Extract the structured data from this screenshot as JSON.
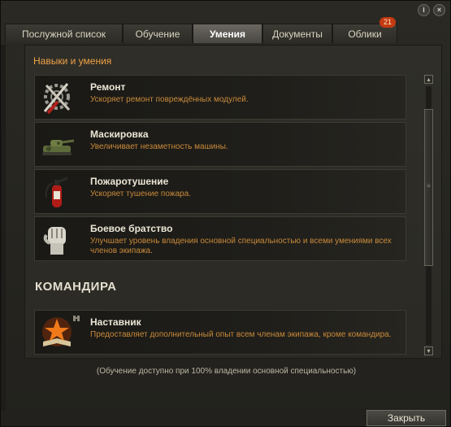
{
  "window": {
    "help_icon": "info-icon",
    "close_icon": "close-icon",
    "help_label": "i",
    "close_label": "×"
  },
  "tabs": [
    {
      "label": "Послужной список"
    },
    {
      "label": "Обучение"
    },
    {
      "label": "Умения",
      "active": true
    },
    {
      "label": "Документы"
    },
    {
      "label": "Облики",
      "badge": "21"
    }
  ],
  "section": {
    "title": "Навыки и умения"
  },
  "skills": [
    {
      "name": "Ремонт",
      "description": "Ускоряет ремонт повреждённых модулей.",
      "icon": "repair-icon"
    },
    {
      "name": "Маскировка",
      "description": "Увеличивает незаметность машины.",
      "icon": "camouflage-tank-icon"
    },
    {
      "name": "Пожаротушение",
      "description": "Ускоряет тушение пожара.",
      "icon": "fire-extinguisher-icon"
    },
    {
      "name": "Боевое братство",
      "description": "Улучшает уровень владения основной специальностью и всеми умениями всех членов экипажа.",
      "icon": "fist-icon"
    }
  ],
  "commander": {
    "group_title": "КОМАНДИРА",
    "skills": [
      {
        "name": "Наставник",
        "description": "Предоставляет дополнительный опыт всем членам экипажа, кроме командира.",
        "icon": "mentor-book-star-icon"
      }
    ]
  },
  "footnote": "(Обучение доступно при 100% владении основной специальностью)",
  "buttons": {
    "close_label": "Закрыть"
  },
  "colors": {
    "accent_orange": "#f0a248",
    "description_orange": "#c98a3a",
    "badge_red": "#c33a12"
  }
}
